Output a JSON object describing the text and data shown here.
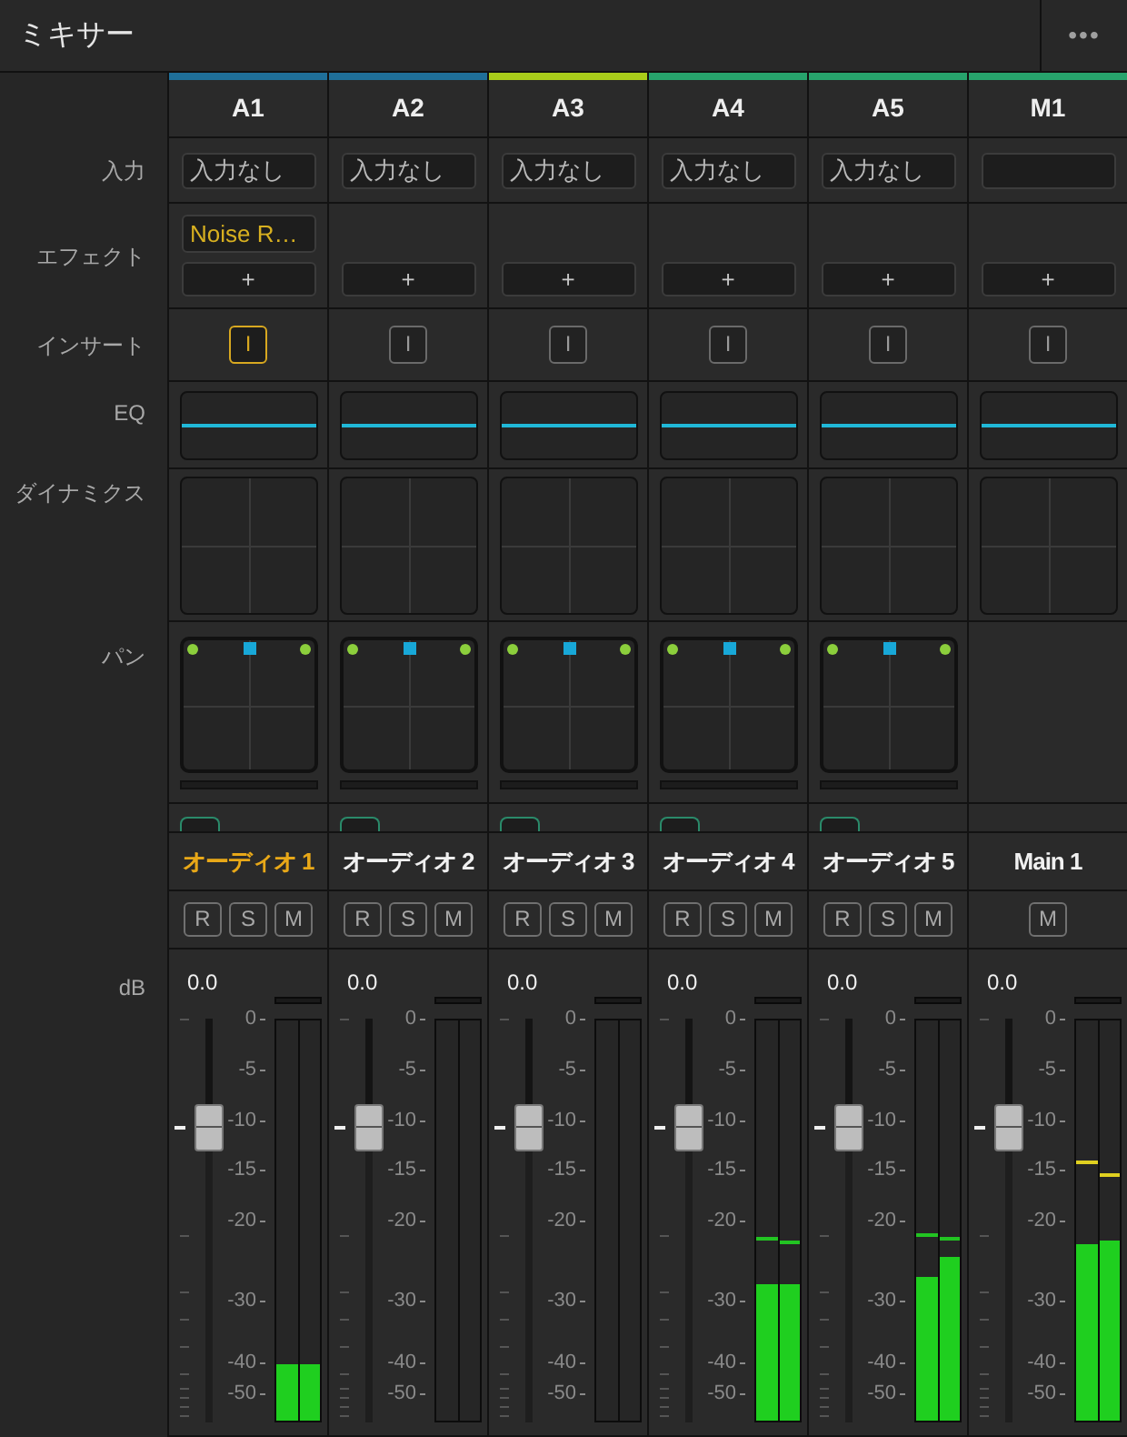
{
  "panel": {
    "title": "ミキサー",
    "menu": "•••"
  },
  "row_labels": {
    "input": "入力",
    "effects": "エフェクト",
    "insert": "インサート",
    "eq": "EQ",
    "dynamics": "ダイナミクス",
    "pan": "パン",
    "db": "dB"
  },
  "channels": [
    {
      "bus": "A1",
      "color": "#1f6f99",
      "input": "入力なし",
      "effects": [
        "Noise R…"
      ],
      "add_effect": "+",
      "insert": {
        "label": "I",
        "on": true
      },
      "pan": true,
      "track": {
        "name": "オーディオ 1",
        "selected": true
      },
      "buttons": [
        "R",
        "S",
        "M"
      ],
      "gain": "0.0",
      "fader": {
        "level": 0.73
      },
      "scale": [
        "0",
        "-5",
        "-10",
        "-15",
        "-20",
        "-30",
        "-40",
        "-50"
      ],
      "meters": [
        {
          "level": 0.14
        },
        {
          "level": 0.14
        }
      ]
    },
    {
      "bus": "A2",
      "color": "#1f6f99",
      "input": "入力なし",
      "add_effect": "+",
      "insert": {
        "label": "I",
        "on": false
      },
      "pan": true,
      "track": {
        "name": "オーディオ 2",
        "selected": false
      },
      "buttons": [
        "R",
        "S",
        "M"
      ],
      "gain": "0.0",
      "fader": {
        "level": 0.73
      },
      "scale": [
        "0",
        "-5",
        "-10",
        "-15",
        "-20",
        "-30",
        "-40",
        "-50"
      ],
      "meters": [
        {
          "level": 0
        },
        {
          "level": 0
        }
      ]
    },
    {
      "bus": "A3",
      "color": "#a8cc1a",
      "input": "入力なし",
      "add_effect": "+",
      "insert": {
        "label": "I",
        "on": false
      },
      "pan": true,
      "track": {
        "name": "オーディオ 3",
        "selected": false
      },
      "buttons": [
        "R",
        "S",
        "M"
      ],
      "gain": "0.0",
      "fader": {
        "level": 0.73
      },
      "scale": [
        "0",
        "-5",
        "-10",
        "-15",
        "-20",
        "-30",
        "-40",
        "-50"
      ],
      "meters": [
        {
          "level": 0
        },
        {
          "level": 0
        }
      ]
    },
    {
      "bus": "A4",
      "color": "#27a36c",
      "input": "入力なし",
      "add_effect": "+",
      "insert": {
        "label": "I",
        "on": false
      },
      "pan": true,
      "track": {
        "name": "オーディオ 4",
        "selected": false
      },
      "buttons": [
        "R",
        "S",
        "M"
      ],
      "gain": "0.0",
      "fader": {
        "level": 0.73
      },
      "scale": [
        "0",
        "-5",
        "-10",
        "-15",
        "-20",
        "-30",
        "-40",
        "-50"
      ],
      "meters": [
        {
          "level": 0.34,
          "peak": {
            "level": 0.45,
            "color": "#22c422"
          }
        },
        {
          "level": 0.34,
          "peak": {
            "level": 0.44,
            "color": "#22c422"
          }
        }
      ]
    },
    {
      "bus": "A5",
      "color": "#27a36c",
      "input": "入力なし",
      "add_effect": "+",
      "insert": {
        "label": "I",
        "on": false
      },
      "pan": true,
      "track": {
        "name": "オーディオ 5",
        "selected": false
      },
      "buttons": [
        "R",
        "S",
        "M"
      ],
      "gain": "0.0",
      "fader": {
        "level": 0.73
      },
      "scale": [
        "0",
        "-5",
        "-10",
        "-15",
        "-20",
        "-30",
        "-40",
        "-50"
      ],
      "meters": [
        {
          "level": 0.36,
          "peak": {
            "level": 0.46,
            "color": "#22c422"
          }
        },
        {
          "level": 0.41,
          "peak": {
            "level": 0.45,
            "color": "#22c422"
          }
        }
      ]
    },
    {
      "bus": "M1",
      "color": "#27a36c",
      "add_effect": "+",
      "insert": {
        "label": "I",
        "on": false
      },
      "pan": false,
      "track": {
        "name": "Main 1",
        "selected": false
      },
      "buttons": [
        "M"
      ],
      "gain": "0.0",
      "fader": {
        "level": 0.73
      },
      "scale": [
        "0",
        "-5",
        "-10",
        "-15",
        "-20",
        "-30",
        "-40",
        "-50"
      ],
      "meters": [
        {
          "level": 0.44,
          "peak": {
            "level": 0.64,
            "color": "#e0d020"
          }
        },
        {
          "level": 0.45,
          "peak": {
            "level": 0.61,
            "color": "#e0d020"
          }
        }
      ]
    }
  ]
}
